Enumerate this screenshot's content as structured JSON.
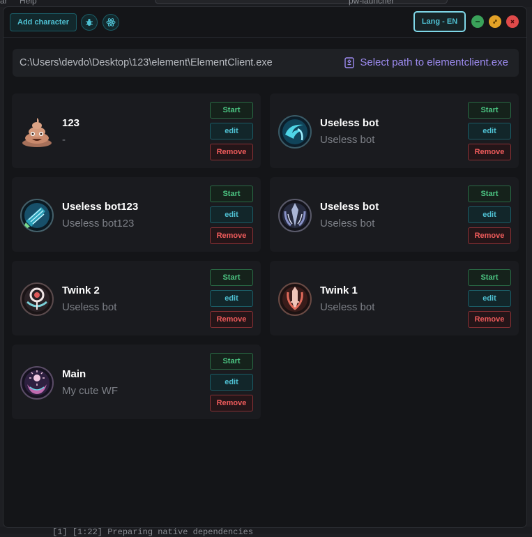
{
  "background": {
    "menu": [
      "ar",
      "Help"
    ],
    "tab_title": "pw-launcher",
    "terminal_line": "[1] [1:22] Preparing native dependencies"
  },
  "toolbar": {
    "add_label": "Add character",
    "bug_icon": "bug-icon",
    "react_icon": "atom-icon",
    "lang_label": "Lang - EN"
  },
  "path": {
    "value": "C:\\Users\\devdo\\Desktop\\123\\element\\ElementClient.exe",
    "select_label": "Select path to elementclient.exe"
  },
  "actions": {
    "start": "Start",
    "edit": "edit",
    "remove": "Remove"
  },
  "characters": [
    {
      "name": "123",
      "desc": "-",
      "avatar": "poop-emoji"
    },
    {
      "name": "Useless bot",
      "desc": "Useless bot",
      "avatar": "class-emblem-blue"
    },
    {
      "name": "Useless bot123",
      "desc": "Useless bot123",
      "avatar": "class-emblem-teal"
    },
    {
      "name": "Useless bot",
      "desc": "Useless bot",
      "avatar": "class-emblem-silver"
    },
    {
      "name": "Twink 2",
      "desc": "Useless bot",
      "avatar": "class-emblem-red-ring"
    },
    {
      "name": "Twink 1",
      "desc": "Useless bot",
      "avatar": "class-emblem-red-sword"
    },
    {
      "name": "Main",
      "desc": "My cute WF",
      "avatar": "class-emblem-purple"
    }
  ],
  "colors": {
    "accent_cyan": "#4fc1d3",
    "start_green": "#4cc683",
    "remove_red": "#ef5b5b",
    "link_purple": "#9d8bf0"
  }
}
